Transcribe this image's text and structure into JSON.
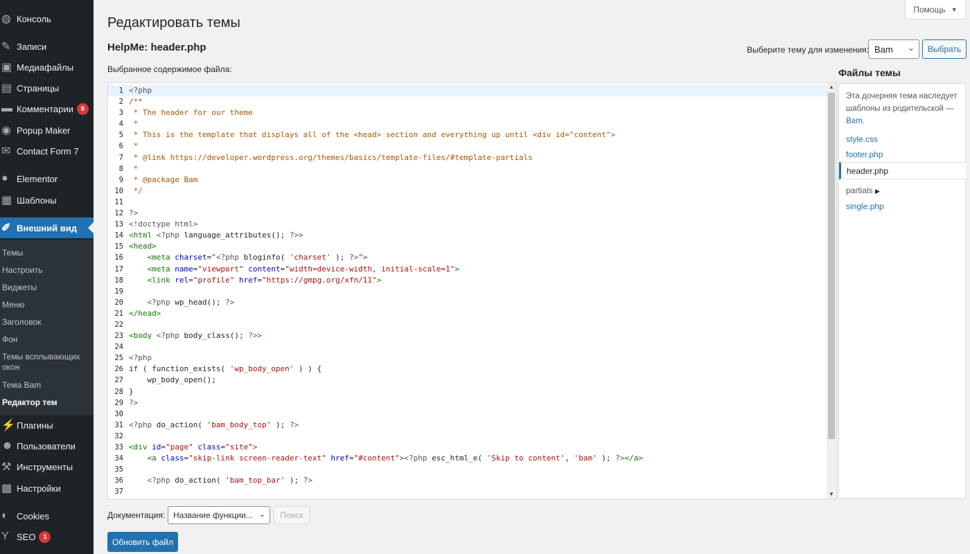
{
  "sidebar": {
    "items": [
      {
        "label": "Консоль",
        "icon": "dashboard-icon",
        "glyph": "◍"
      },
      {
        "label": "Записи",
        "icon": "pin-icon",
        "glyph": "✎"
      },
      {
        "label": "Медиафайлы",
        "icon": "media-icon",
        "glyph": "▣"
      },
      {
        "label": "Страницы",
        "icon": "pages-icon",
        "glyph": "▤"
      },
      {
        "label": "Комментарии",
        "icon": "comments-icon",
        "glyph": "▬",
        "badge": "8"
      },
      {
        "label": "Popup Maker",
        "icon": "popup-icon",
        "glyph": "◉"
      },
      {
        "label": "Contact Form 7",
        "icon": "mail-icon",
        "glyph": "✉"
      },
      {
        "label": "Elementor",
        "icon": "elementor-icon",
        "glyph": "●"
      },
      {
        "label": "Шаблоны",
        "icon": "templates-icon",
        "glyph": "▦"
      },
      {
        "label": "Внешний вид",
        "icon": "appearance-icon",
        "glyph": "✐"
      },
      {
        "label": "Плагины",
        "icon": "plugins-icon",
        "glyph": "⚡"
      },
      {
        "label": "Пользователи",
        "icon": "users-icon",
        "glyph": "☻"
      },
      {
        "label": "Инструменты",
        "icon": "tools-icon",
        "glyph": "⚒"
      },
      {
        "label": "Настройки",
        "icon": "settings-icon",
        "glyph": "▩"
      },
      {
        "label": "Cookies",
        "icon": "cookies-icon",
        "glyph": "◐"
      },
      {
        "label": "SEO",
        "icon": "seo-icon",
        "glyph": "Y",
        "badge": "1"
      }
    ],
    "submenu": [
      "Темы",
      "Настроить",
      "Виджеты",
      "Меню",
      "Заголовок",
      "Фон",
      "Темы всплывающих окон",
      "Тема Bam",
      "Редактор тем"
    ]
  },
  "header": {
    "help": "Помощь",
    "page_title": "Редактировать темы",
    "file_title": "HelpMe: header.php",
    "theme_select_label": "Выберите тему для изменения:",
    "theme_select_value": "Bam",
    "choose_button": "Выбрать",
    "content_label": "Выбранное содержимое файла:"
  },
  "editor": {
    "lines": [
      [
        [
          "c-php",
          "<?php"
        ]
      ],
      [
        [
          "c-com",
          "/**"
        ]
      ],
      [
        [
          "c-com",
          " * The header for our theme"
        ]
      ],
      [
        [
          "c-com",
          " *"
        ]
      ],
      [
        [
          "c-com",
          " * This is the template that displays all of the <head> section and everything up until <div id=\"content\">"
        ]
      ],
      [
        [
          "c-com",
          " *"
        ]
      ],
      [
        [
          "c-com",
          " * @link https://developer.wordpress.org/themes/basics/template-files/#template-partials"
        ]
      ],
      [
        [
          "c-com",
          " *"
        ]
      ],
      [
        [
          "c-com",
          " * @package Bam"
        ]
      ],
      [
        [
          "c-com",
          " */"
        ]
      ],
      [
        [
          "c-plain",
          ""
        ]
      ],
      [
        [
          "c-php",
          "?>"
        ]
      ],
      [
        [
          "c-php",
          "<!doctype html>"
        ]
      ],
      [
        [
          "c-tag",
          "<html "
        ],
        [
          "c-php",
          "<?php "
        ],
        [
          "c-plain",
          "language_attributes(); "
        ],
        [
          "c-php",
          "?>"
        ],
        [
          "c-tag",
          ">"
        ]
      ],
      [
        [
          "c-tag",
          "<head>"
        ]
      ],
      [
        [
          "c-plain",
          "    "
        ],
        [
          "c-tag",
          "<meta "
        ],
        [
          "c-attr",
          "charset"
        ],
        [
          "c-plain",
          "="
        ],
        [
          "c-str",
          "\""
        ],
        [
          "c-php",
          "<?php "
        ],
        [
          "c-plain",
          "bloginfo( "
        ],
        [
          "c-str",
          "'charset'"
        ],
        [
          "c-plain",
          " ); "
        ],
        [
          "c-php",
          "?>"
        ],
        [
          "c-str",
          "\""
        ],
        [
          "c-tag",
          ">"
        ]
      ],
      [
        [
          "c-plain",
          "    "
        ],
        [
          "c-tag",
          "<meta "
        ],
        [
          "c-attr",
          "name"
        ],
        [
          "c-plain",
          "="
        ],
        [
          "c-str",
          "\"viewport\""
        ],
        [
          "c-attr",
          " content"
        ],
        [
          "c-plain",
          "="
        ],
        [
          "c-str",
          "\"width=device-width, initial-scale=1\""
        ],
        [
          "c-tag",
          ">"
        ]
      ],
      [
        [
          "c-plain",
          "    "
        ],
        [
          "c-tag",
          "<link "
        ],
        [
          "c-attr",
          "rel"
        ],
        [
          "c-plain",
          "="
        ],
        [
          "c-str",
          "\"profile\""
        ],
        [
          "c-attr",
          " href"
        ],
        [
          "c-plain",
          "="
        ],
        [
          "c-str",
          "\"https://gmpg.org/xfn/11\""
        ],
        [
          "c-tag",
          ">"
        ]
      ],
      [
        [
          "c-plain",
          ""
        ]
      ],
      [
        [
          "c-plain",
          "    "
        ],
        [
          "c-php",
          "<?php "
        ],
        [
          "c-plain",
          "wp_head(); "
        ],
        [
          "c-php",
          "?>"
        ]
      ],
      [
        [
          "c-tag",
          "</head>"
        ]
      ],
      [
        [
          "c-plain",
          ""
        ]
      ],
      [
        [
          "c-tag",
          "<body "
        ],
        [
          "c-php",
          "<?php "
        ],
        [
          "c-plain",
          "body_class(); "
        ],
        [
          "c-php",
          "?>"
        ],
        [
          "c-tag",
          ">"
        ]
      ],
      [
        [
          "c-plain",
          ""
        ]
      ],
      [
        [
          "c-php",
          "<?php"
        ]
      ],
      [
        [
          "c-kw",
          "if"
        ],
        [
          "c-plain",
          " ( function_exists( "
        ],
        [
          "c-str",
          "'wp_body_open'"
        ],
        [
          "c-plain",
          " ) ) {"
        ]
      ],
      [
        [
          "c-plain",
          "    wp_body_open();"
        ]
      ],
      [
        [
          "c-plain",
          "}"
        ]
      ],
      [
        [
          "c-php",
          "?>"
        ]
      ],
      [
        [
          "c-plain",
          ""
        ]
      ],
      [
        [
          "c-php",
          "<?php "
        ],
        [
          "c-plain",
          "do_action( "
        ],
        [
          "c-str",
          "'bam_body_top'"
        ],
        [
          "c-plain",
          " ); "
        ],
        [
          "c-php",
          "?>"
        ]
      ],
      [
        [
          "c-plain",
          ""
        ]
      ],
      [
        [
          "c-tag",
          "<div "
        ],
        [
          "c-attr",
          "id"
        ],
        [
          "c-plain",
          "="
        ],
        [
          "c-str",
          "\"page\""
        ],
        [
          "c-attr",
          " class"
        ],
        [
          "c-plain",
          "="
        ],
        [
          "c-str",
          "\"site\""
        ],
        [
          "c-tag",
          ">"
        ]
      ],
      [
        [
          "c-plain",
          "    "
        ],
        [
          "c-tag",
          "<a "
        ],
        [
          "c-attr",
          "class"
        ],
        [
          "c-plain",
          "="
        ],
        [
          "c-str",
          "\"skip-link screen-reader-text\""
        ],
        [
          "c-attr",
          " href"
        ],
        [
          "c-plain",
          "="
        ],
        [
          "c-str",
          "\"#content\""
        ],
        [
          "c-tag",
          ">"
        ],
        [
          "c-php",
          "<?php "
        ],
        [
          "c-plain",
          "esc_html_e( "
        ],
        [
          "c-str",
          "'Skip to content'"
        ],
        [
          "c-plain",
          ", "
        ],
        [
          "c-str",
          "'bam'"
        ],
        [
          "c-plain",
          " ); "
        ],
        [
          "c-php",
          "?>"
        ],
        [
          "c-tag",
          "</a>"
        ]
      ],
      [
        [
          "c-plain",
          ""
        ]
      ],
      [
        [
          "c-plain",
          "    "
        ],
        [
          "c-php",
          "<?php "
        ],
        [
          "c-plain",
          "do_action( "
        ],
        [
          "c-str",
          "'bam_top_bar'"
        ],
        [
          "c-plain",
          " ); "
        ],
        [
          "c-php",
          "?>"
        ]
      ],
      [
        [
          "c-plain",
          ""
        ]
      ]
    ]
  },
  "files": {
    "title": "Файлы темы",
    "note_text": "Эта дочерняя тема наследует шаблоны из родительской — ",
    "note_link": "Bam",
    "note_end": ".",
    "style": "style.css",
    "footer": "footer.php",
    "header": "header.php",
    "partials": "partials",
    "single": "single.php"
  },
  "bottom": {
    "doc_label": "Документация:",
    "doc_select": "Название функции...",
    "search": "Поиск",
    "update": "Обновить файл"
  }
}
